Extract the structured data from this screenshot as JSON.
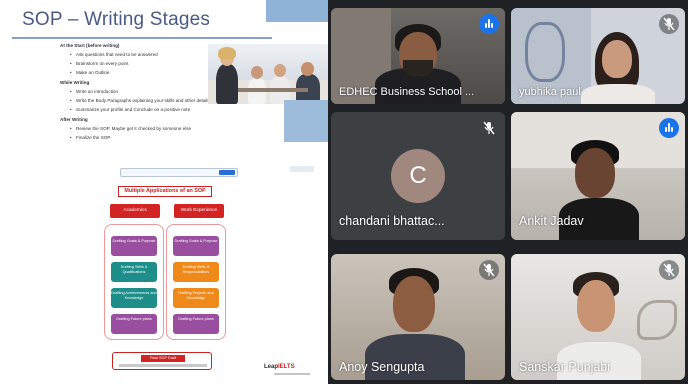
{
  "slide": {
    "title": "SOP – Writing Stages",
    "sections": [
      {
        "heading": "At the Start (before writing)",
        "bullets": [
          "Ask questions that need to be answered",
          "Brainstorm on every point",
          "Make an Outline"
        ]
      },
      {
        "heading": "While Writing",
        "bullets": [
          "Write an introduction",
          "Write the Body Paragraphs explaining your skills and other details",
          "Summarize your profile and Conclude on a positive note"
        ]
      },
      {
        "heading": "After Writing",
        "bullets": [
          "Review the SOP. Maybe get it checked by someone else",
          "Finalize the SOP"
        ]
      }
    ]
  },
  "flowchart": {
    "title": "Multiple Applications of an SOP",
    "left_header": "Academics",
    "right_header": "Work Experience",
    "left_cells": [
      "Drafting\nGoals & Purpose",
      "Drafting\nSkills &\nQualifications",
      "Drafting\nAchievements\nand Knowledge",
      "Drafting\nFuture plans"
    ],
    "right_cells": [
      "Drafting\nGoals & Purpose",
      "Drafting\nSkills &\nResponsibilities",
      "Drafting\nProjects\nand Knowledge",
      "Drafting\nFuture plans"
    ],
    "final_label": "Final SOP Draft",
    "brand_prefix": "Leap",
    "brand_suffix": "IELTS"
  },
  "participants": [
    {
      "name": "EDHEC Business School ...",
      "state": "speaking"
    },
    {
      "name": "yubhika paul",
      "state": "muted"
    },
    {
      "name": "chandani bhattac...",
      "state": "muted",
      "initial": "C"
    },
    {
      "name": "Ankit Jadav",
      "state": "speaking"
    },
    {
      "name": "Anoy Sengupta",
      "state": "muted"
    },
    {
      "name": "Sanskar Punjabi",
      "state": "muted"
    }
  ],
  "colors": {
    "speaking_indicator": "#1a73e8",
    "active_border": "#8ab4f8",
    "avatar_bg": "#a1887f",
    "grid_bg": "#202124",
    "slide_title": "#4a5a86",
    "flow_red": "#d42323"
  },
  "icons": [
    "speaking-indicator-icon",
    "mic-off-icon"
  ]
}
